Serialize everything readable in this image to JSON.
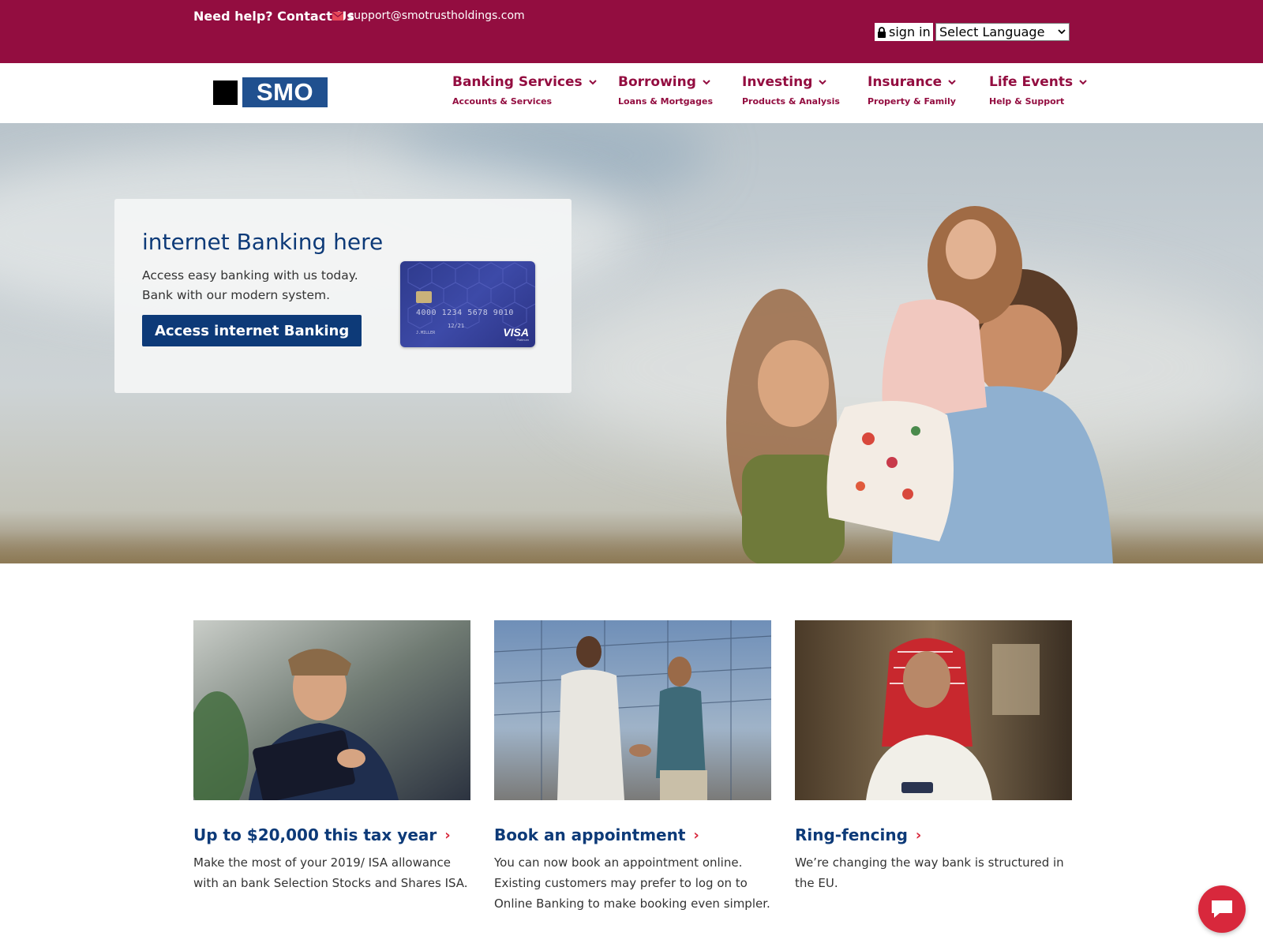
{
  "topbar": {
    "help": "Need help? Contact Us",
    "email": "support@smotrustholdings.com",
    "sign_in": "sign in",
    "language": "Select Language"
  },
  "logo": {
    "text": "SMO"
  },
  "nav": [
    {
      "title": "Banking Services",
      "sub": "Accounts & Services"
    },
    {
      "title": "Borrowing",
      "sub": "Loans & Mortgages"
    },
    {
      "title": "Investing",
      "sub": "Products & Analysis"
    },
    {
      "title": "Insurance",
      "sub": "Property & Family"
    },
    {
      "title": "Life Events",
      "sub": "Help & Support"
    }
  ],
  "hero": {
    "title": "internet Banking here",
    "desc_line1": "Access easy banking with us today.",
    "desc_line2": "Bank with our modern system.",
    "cta": "Access internet Banking",
    "card": {
      "number": "4000 1234 5678 9010",
      "expiry": "12/21",
      "holder": "J.MILLER",
      "brand": "VISA",
      "tier": "Platinum"
    }
  },
  "features": [
    {
      "title": "Up to $20,000 this tax year",
      "desc": "Make the most of your 2019/ ISA allowance with an bank Selection Stocks and Shares ISA."
    },
    {
      "title": "Book an appointment",
      "desc": "You can now book an appointment online. Existing customers may prefer to log on to Online Banking to make booking even simpler."
    },
    {
      "title": "Ring-fencing",
      "desc": "We’re changing the way bank is structured in the EU."
    }
  ],
  "colors": {
    "brand_maroon": "#930d40",
    "brand_navy": "#0d3a78",
    "logo_blue": "#20508f",
    "accent_red": "#d8283c"
  },
  "icons": {
    "email": "envelope-icon",
    "lock": "lock-icon",
    "chevron": "chevron-down-icon",
    "arrow": "chevron-right-icon",
    "chat": "chat-bubble-icon"
  }
}
